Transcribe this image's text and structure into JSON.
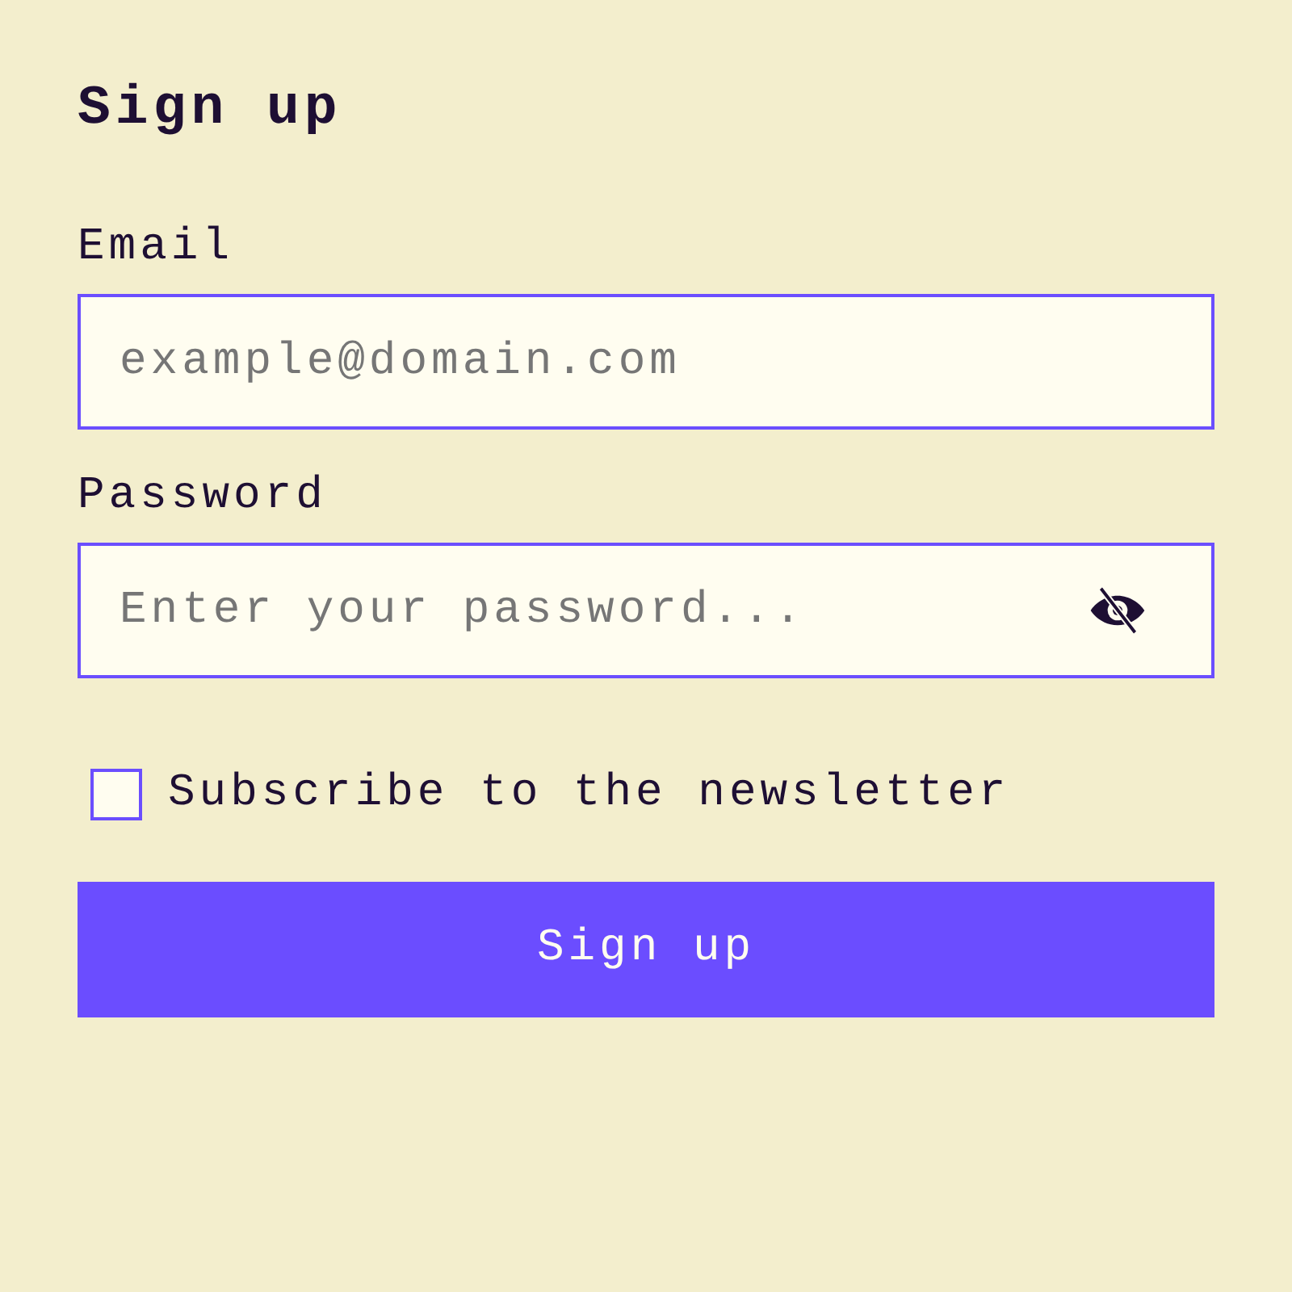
{
  "title": "Sign up",
  "fields": [
    {
      "label": "Email",
      "placeholder": "example@domain.com",
      "kind": "text"
    },
    {
      "label": "Password",
      "placeholder": "Enter your password...",
      "kind": "password"
    }
  ],
  "newsletter": {
    "label": "Subscribe to the newsletter",
    "checked": false
  },
  "submit": {
    "label": "Sign up"
  }
}
